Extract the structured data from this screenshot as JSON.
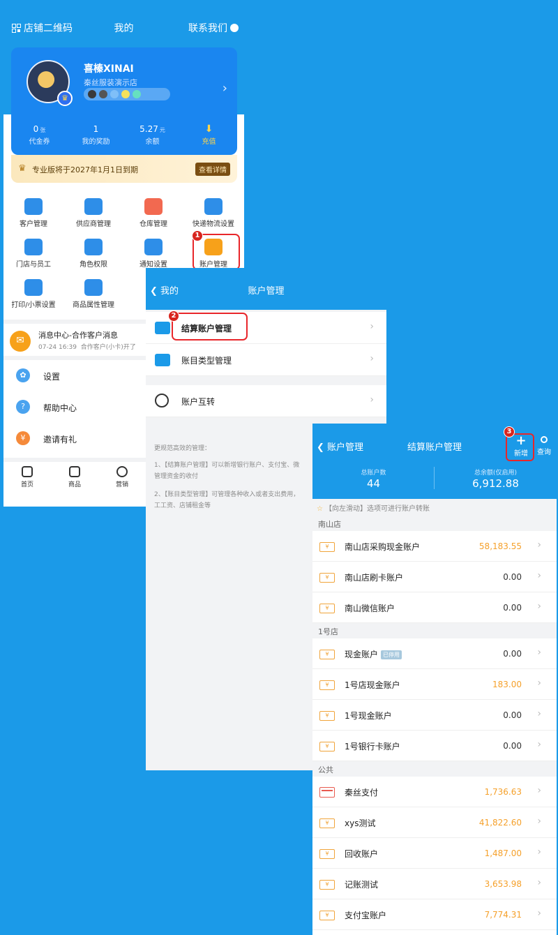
{
  "mine": {
    "header": {
      "left": "店铺二维码",
      "title": "我的",
      "right": "联系我们"
    },
    "user": {
      "name": "喜榛XINAI",
      "shop": "秦丝服装演示店"
    },
    "stats": [
      {
        "value": "0",
        "unit": "张",
        "label": "代金券"
      },
      {
        "value": "1",
        "unit": "",
        "label": "我的奖励"
      },
      {
        "value": "5.27",
        "unit": "元",
        "label": "余额"
      },
      {
        "label": "充值"
      }
    ],
    "vip": {
      "text": "专业版将于2027年1月1日到期",
      "button": "查看详情"
    },
    "grid": [
      {
        "label": "客户管理",
        "color": "#2e8ee8"
      },
      {
        "label": "供应商管理",
        "color": "#2e8ee8"
      },
      {
        "label": "仓库管理",
        "color": "#f26950"
      },
      {
        "label": "快递物流设置",
        "color": "#2e8ee8"
      },
      {
        "label": "门店与员工",
        "color": "#2e8ee8"
      },
      {
        "label": "角色权限",
        "color": "#2e8ee8"
      },
      {
        "label": "通知设置",
        "color": "#2e8ee8"
      },
      {
        "label": "账户管理",
        "color": "#f7a11a"
      },
      {
        "label": "打印/小票设置",
        "color": "#2e8ee8"
      },
      {
        "label": "商品属性管理",
        "color": "#2e8ee8"
      }
    ],
    "message": {
      "title": "消息中心-合作客户消息",
      "time": "07-24 16:39",
      "preview": "合作客户(小卡)开了"
    },
    "menu": [
      {
        "label": "设置",
        "color": "#4aa3ef"
      },
      {
        "label": "帮助中心",
        "color": "#4aa3ef"
      },
      {
        "label": "邀请有礼",
        "color": "#f58a3a"
      }
    ],
    "tabs": [
      "首页",
      "商品",
      "营销"
    ]
  },
  "account_mgmt": {
    "back": "我的",
    "title": "账户管理",
    "items": [
      "结算账户管理",
      "账目类型管理",
      "账户互转"
    ],
    "notes": {
      "heading": "更规范高效的管理：",
      "line1": "1、【结算账户管理】可以新增银行账户、支付宝、微",
      "line1b": "管理资金的收付",
      "line2": "2、【账目类型管理】可管理各种收入或者支出费用，",
      "line2b": "工工资、店铺租金等"
    }
  },
  "settlement": {
    "back": "账户管理",
    "title": "结算账户管理",
    "add": "新增",
    "search": "查询",
    "total_accounts_label": "总账户数",
    "total_accounts": "44",
    "total_balance_label": "总余额(仅启用)",
    "total_balance": "6,912.88",
    "tip": "【向左滑动】选项可进行账户转账",
    "disabled_tag": "已停用",
    "sections": [
      {
        "name": "南山店",
        "rows": [
          {
            "name": "南山店采购现金账户",
            "amount": "58,183.55",
            "orange": true,
            "icon": "yen"
          },
          {
            "name": "南山店刷卡账户",
            "amount": "0.00",
            "orange": false,
            "icon": "yen"
          },
          {
            "name": "南山微信账户",
            "amount": "0.00",
            "orange": false,
            "icon": "yen"
          }
        ]
      },
      {
        "name": "1号店",
        "rows": [
          {
            "name": "现金账户",
            "amount": "0.00",
            "orange": false,
            "icon": "yen",
            "disabled": true
          },
          {
            "name": "1号店现金账户",
            "amount": "183.00",
            "orange": true,
            "icon": "yen"
          },
          {
            "name": "1号现金账户",
            "amount": "0.00",
            "orange": false,
            "icon": "yen"
          },
          {
            "name": "1号银行卡账户",
            "amount": "0.00",
            "orange": false,
            "icon": "yen"
          }
        ]
      },
      {
        "name": "公共",
        "rows": [
          {
            "name": "秦丝支付",
            "amount": "1,736.63",
            "orange": true,
            "icon": "card"
          },
          {
            "name": "xys测试",
            "amount": "41,822.60",
            "orange": true,
            "icon": "yen"
          },
          {
            "name": "回收账户",
            "amount": "1,487.00",
            "orange": true,
            "icon": "yen"
          },
          {
            "name": "记账测试",
            "amount": "3,653.98",
            "orange": true,
            "icon": "yen"
          },
          {
            "name": "支付宝账户",
            "amount": "7,774.31",
            "orange": true,
            "icon": "yen"
          }
        ]
      }
    ]
  },
  "steps": [
    "1",
    "2",
    "3"
  ]
}
